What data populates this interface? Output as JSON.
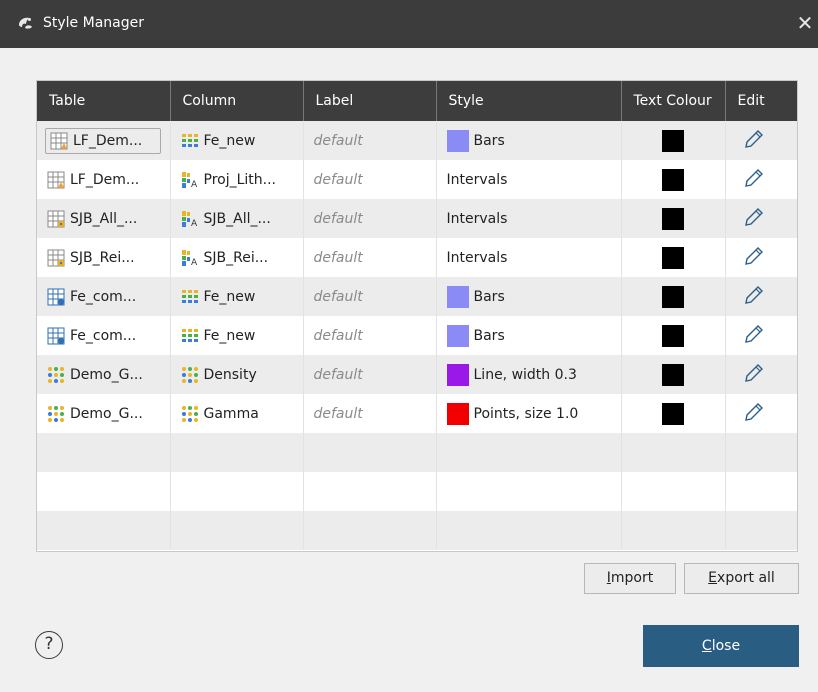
{
  "window": {
    "title": "Style Manager",
    "close_glyph": "✕"
  },
  "columns": [
    "Table",
    "Column",
    "Label",
    "Style",
    "Text Colour",
    "Edit"
  ],
  "rows": [
    {
      "table": "LF_Dem...",
      "table_icon": "table-warning-icon",
      "table_selected": true,
      "column": "Fe_new",
      "column_icon": "numeric-column-icon",
      "label": "default",
      "style": "Bars",
      "swatch": "#8b8bf5",
      "text_colour": "#000000"
    },
    {
      "table": "LF_Dem...",
      "table_icon": "table-warning-icon",
      "column": "Proj_Lith...",
      "column_icon": "category-column-icon",
      "label": "default",
      "style": "Intervals",
      "swatch": null,
      "text_colour": "#000000"
    },
    {
      "table": "SJB_All_...",
      "table_icon": "table-lith-icon",
      "column": "SJB_All_...",
      "column_icon": "category-column-icon",
      "label": "default",
      "style": "Intervals",
      "swatch": null,
      "text_colour": "#000000"
    },
    {
      "table": "SJB_Rei...",
      "table_icon": "table-lith-icon",
      "column": "SJB_Rei...",
      "column_icon": "category-column-icon",
      "label": "default",
      "style": "Intervals",
      "swatch": null,
      "text_colour": "#000000"
    },
    {
      "table": "Fe_com...",
      "table_icon": "table-composite-icon",
      "column": "Fe_new",
      "column_icon": "numeric-column-icon",
      "label": "default",
      "style": "Bars",
      "swatch": "#8b8bf5",
      "text_colour": "#000000"
    },
    {
      "table": "Fe_com...",
      "table_icon": "table-composite-icon",
      "column": "Fe_new",
      "column_icon": "numeric-column-icon",
      "label": "default",
      "style": "Bars",
      "swatch": "#8b8bf5",
      "text_colour": "#000000"
    },
    {
      "table": "Demo_G...",
      "table_icon": "downhole-data-icon",
      "column": "Density",
      "column_icon": "downhole-data-icon",
      "label": "default",
      "style": "Line, width 0.3",
      "swatch": "#9a18e8",
      "text_colour": "#000000"
    },
    {
      "table": "Demo_G...",
      "table_icon": "downhole-data-icon",
      "column": "Gamma",
      "column_icon": "downhole-data-icon",
      "label": "default",
      "style": "Points, size 1.0",
      "swatch": "#f20000",
      "text_colour": "#000000"
    }
  ],
  "empty_rows": 3,
  "buttons": {
    "import": "Import",
    "import_mnemonic": "I",
    "import_rest": "mport",
    "export_all": "Export all",
    "export_mnemonic": "E",
    "export_rest": "xport all",
    "close": "Close",
    "close_mnemonic": "C",
    "close_rest": "lose",
    "help": "?"
  }
}
